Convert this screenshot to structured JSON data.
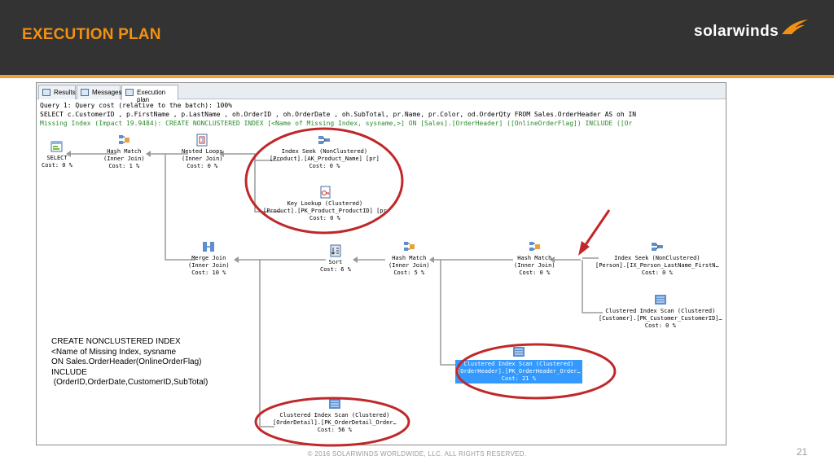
{
  "slide": {
    "title": "EXECUTION PLAN",
    "logo_text": "solarwinds",
    "footer": "© 2016 SOLARWINDS WORLDWIDE, LLC. ALL RIGHTS RESERVED.",
    "page_number": "21"
  },
  "colors": {
    "header_bg": "#333333",
    "title": "#f29111",
    "accent_stripe": "#f0a030",
    "highlight_circle": "#c0282a",
    "selected_node": "#3399ff"
  },
  "tabs": [
    {
      "label": "Results",
      "icon": "grid-icon"
    },
    {
      "label": "Messages",
      "icon": "messages-icon"
    },
    {
      "label": "Execution plan",
      "icon": "execution-plan-icon"
    }
  ],
  "query": {
    "line1": "Query 1: Query cost (relative to the batch): 100%",
    "line2": "SELECT c.CustomerID , p.FirstName , p.LastName , oh.OrderID , oh.OrderDate , oh.SubTotal, pr.Name, pr.Color, od.OrderQty FROM Sales.OrderHeader AS oh IN",
    "line3": "Missing Index (Impact 19.9484): CREATE NONCLUSTERED INDEX [<Name of Missing Index, sysname,>] ON [Sales].[OrderHeader] ([OnlineOrderFlag]) INCLUDE ([Or"
  },
  "nodes": {
    "select": {
      "name": "SELECT",
      "cost": "Cost: 0 %"
    },
    "hash_match_1": {
      "name": "Hash Match",
      "detail": "(Inner Join)",
      "cost": "Cost: 1 %"
    },
    "nested_loops": {
      "name": "Nested Loops",
      "detail": "(Inner Join)",
      "cost": "Cost: 0 %"
    },
    "index_seek_product": {
      "name": "Index Seek (NonClustered)",
      "detail": "[Product].[AK_Product_Name] [pr]",
      "cost": "Cost: 0 %"
    },
    "key_lookup": {
      "name": "Key Lookup (Clustered)",
      "detail": "[Product].[PK_Product_ProductID] [pr",
      "cost": "Cost: 0 %"
    },
    "merge_join": {
      "name": "Merge Join",
      "detail": "(Inner Join)",
      "cost": "Cost: 10 %"
    },
    "sort": {
      "name": "Sort",
      "cost": "Cost: 6 %"
    },
    "hash_match_2": {
      "name": "Hash Match",
      "detail": "(Inner Join)",
      "cost": "Cost: 5 %"
    },
    "hash_match_3": {
      "name": "Hash Match",
      "detail": "(Inner Join)",
      "cost": "Cost: 0 %"
    },
    "index_seek_person": {
      "name": "Index Seek (NonClustered)",
      "detail": "[Person].[IX_Person_LastName_FirstN…",
      "cost": "Cost: 0 %"
    },
    "clustered_scan_customer": {
      "name": "Clustered Index Scan (Clustered)",
      "detail": "[Customer].[PK_Customer_CustomerID]…",
      "cost": "Cost: 0 %"
    },
    "clustered_scan_orderheader": {
      "name": "Clustered Index Scan (Clustered)",
      "detail": "[OrderHeader].[PK_OrderHeader_Order…",
      "cost": "Cost: 21 %"
    },
    "clustered_scan_orderdetail": {
      "name": "Clustered Index Scan (Clustered)",
      "detail": "[OrderDetail].[PK_OrderDetail_Order…",
      "cost": "Cost: 56 %"
    }
  },
  "note": {
    "line1": "CREATE NONCLUSTERED INDEX",
    "line2": "<Name of Missing Index, sysname",
    "line3": "ON Sales.OrderHeader(OnlineOrderFlag)",
    "line4": "INCLUDE",
    "line5": " (OrderID,OrderDate,CustomerID,SubTotal)"
  }
}
